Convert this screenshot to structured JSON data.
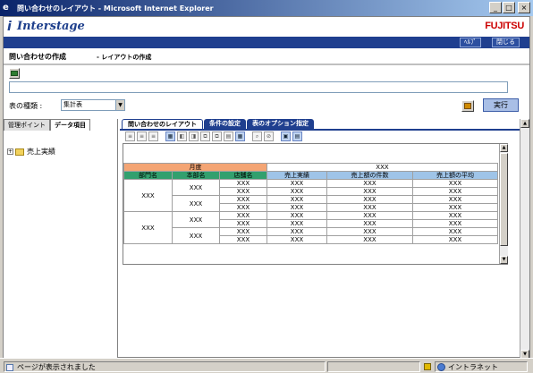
{
  "window": {
    "title": "問い合わせのレイアウト - Microsoft Internet Explorer"
  },
  "brand": {
    "product": "Interstage",
    "vendor": "FUJITSU"
  },
  "nav": {
    "help": "ﾍﾙﾌﾟ",
    "close": "閉じる"
  },
  "page": {
    "title": "問い合わせの作成",
    "subtitle": "- レイアウトの作成"
  },
  "form": {
    "type_label": "表の種類 :",
    "type_value": "集計表",
    "run_label": "実行"
  },
  "left": {
    "tabs": [
      "管理ポイント",
      "データ項目"
    ],
    "tree_item": "売上実績"
  },
  "right_tabs": [
    "問い合わせのレイアウト",
    "条件の設定",
    "表のオプション指定"
  ],
  "grid": {
    "group_month": "月度",
    "group_xxx": "XXX",
    "headers": [
      "部門名",
      "本部名",
      "店舗名",
      "売上実績",
      "売上額の件数",
      "売上額の平均"
    ],
    "cell": "XXX"
  },
  "status": {
    "text": "ページが表示されました",
    "zone": "イントラネット"
  }
}
